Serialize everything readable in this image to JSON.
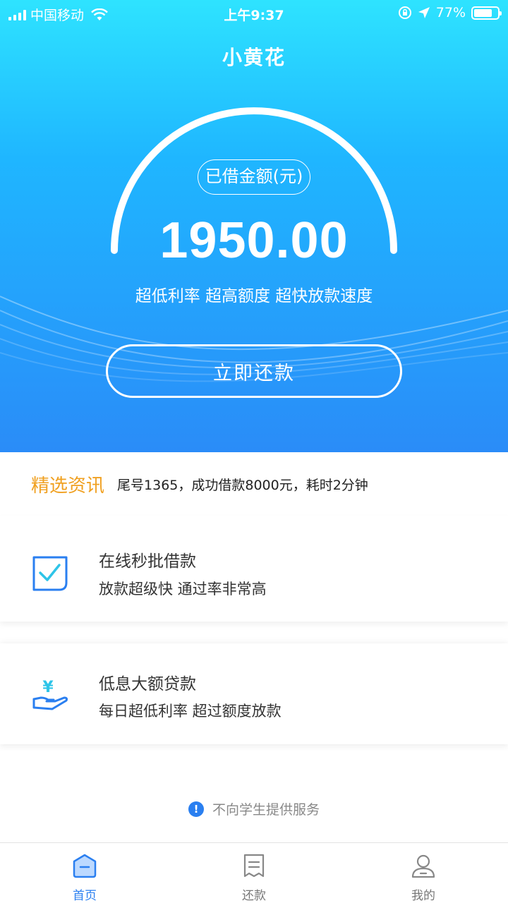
{
  "status_bar": {
    "carrier": "中国移动",
    "time": "上午9:37",
    "battery": "77%",
    "battery_level": 0.77
  },
  "header": {
    "title": "小黄花"
  },
  "loan": {
    "label": "已借金额(元)",
    "amount": "1950.00",
    "slogan": "超低利率 超高额度 超快放款速度",
    "repay_button": "立即还款"
  },
  "news": {
    "tag": "精选资讯",
    "text": "尾号1365，成功借款8000元，耗时2分钟"
  },
  "features": [
    {
      "icon": "checkbox-icon",
      "title": "在线秒批借款",
      "subtitle": "放款超级快 通过率非常高"
    },
    {
      "icon": "yuan-hand-icon",
      "title": "低息大额贷款",
      "subtitle": "每日超低利率 超过额度放款"
    }
  ],
  "notice": {
    "text": "不向学生提供服务"
  },
  "tabs": [
    {
      "label": "首页",
      "icon": "home-icon",
      "active": true
    },
    {
      "label": "还款",
      "icon": "bill-icon",
      "active": false
    },
    {
      "label": "我的",
      "icon": "user-icon",
      "active": false
    }
  ],
  "colors": {
    "accent": "#2a7ff0",
    "news_tag": "#f0a020",
    "hero_top": "#2ee3ff",
    "hero_bottom": "#2a8cf8"
  }
}
